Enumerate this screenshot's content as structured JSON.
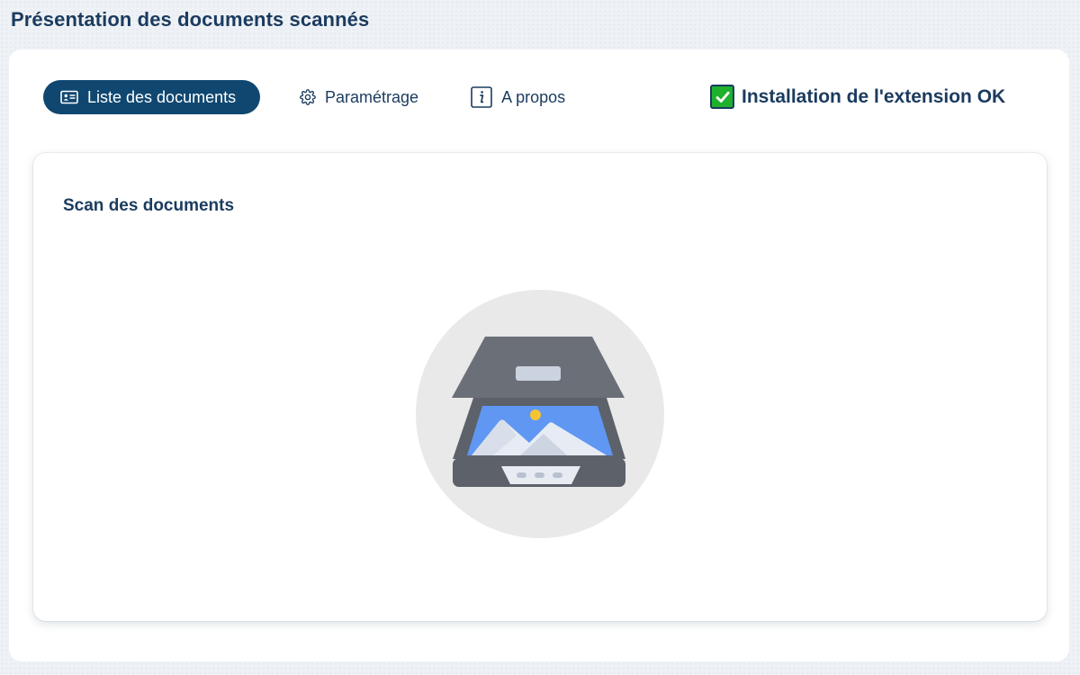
{
  "page": {
    "title": "Présentation des documents scannés"
  },
  "tabs": [
    {
      "label": "Liste des documents",
      "icon": "contact-card-icon",
      "active": true
    },
    {
      "label": "Paramétrage",
      "icon": "gear-icon",
      "active": false
    },
    {
      "label": "A propos",
      "icon": "info-icon",
      "active": false
    }
  ],
  "extension_status": {
    "label": "Installation de l'extension OK",
    "icon": "check-mark-icon",
    "color": "#1fb12c"
  },
  "scan_section": {
    "title": "Scan des documents",
    "illustration": "scanner-icon"
  },
  "colors": {
    "primary": "#0f4770",
    "text": "#1b3b5f",
    "success": "#1fb12c"
  }
}
